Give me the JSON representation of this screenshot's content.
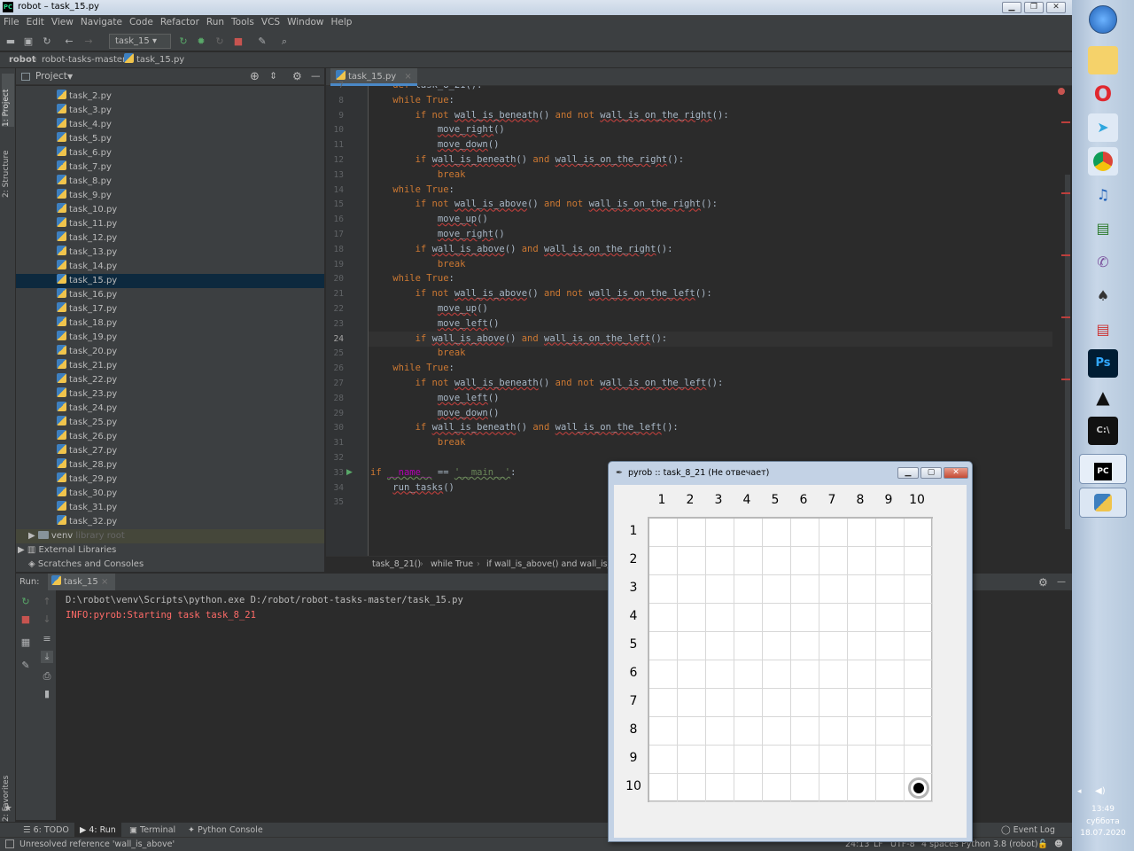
{
  "window": {
    "title": "robot – task_15.py"
  },
  "menu": [
    "File",
    "Edit",
    "View",
    "Navigate",
    "Code",
    "Refactor",
    "Run",
    "Tools",
    "VCS",
    "Window",
    "Help"
  ],
  "toolbar": {
    "run_config": "task_15"
  },
  "breadcrumb": {
    "project": "robot",
    "folder": "robot-tasks-master",
    "file": "task_15.py"
  },
  "left_tabs": {
    "project": "1: Project",
    "structure": "2: Structure",
    "favorites": "2: Favorites"
  },
  "project_panel": {
    "title": "Project",
    "files": [
      "task_2.py",
      "task_3.py",
      "task_4.py",
      "task_5.py",
      "task_6.py",
      "task_7.py",
      "task_8.py",
      "task_9.py",
      "task_10.py",
      "task_11.py",
      "task_12.py",
      "task_13.py",
      "task_14.py",
      "task_15.py",
      "task_16.py",
      "task_17.py",
      "task_18.py",
      "task_19.py",
      "task_20.py",
      "task_21.py",
      "task_22.py",
      "task_23.py",
      "task_24.py",
      "task_25.py",
      "task_26.py",
      "task_27.py",
      "task_28.py",
      "task_29.py",
      "task_30.py",
      "task_31.py",
      "task_32.py"
    ],
    "selected_file": "task_15.py",
    "venv": "venv",
    "venv_note": "library root",
    "external_libraries": "External Libraries",
    "scratches": "Scratches and Consoles"
  },
  "editor": {
    "tab": "task_15.py",
    "current_line": 24,
    "breadcrumb": [
      "task_8_21()",
      "while True",
      "if wall_is_above() and wall_is_..."
    ]
  },
  "run_panel": {
    "label": "Run:",
    "tab": "task_15",
    "console": [
      "D:\\robot\\venv\\Scripts\\python.exe D:/robot/robot-tasks-master/task_15.py",
      "INFO:pyrob:Starting task task_8_21"
    ]
  },
  "bottom_tabs": {
    "todo": "6: TODO",
    "run": "4: Run",
    "terminal": "Terminal",
    "python_console": "Python Console",
    "event_log": "Event Log"
  },
  "status": {
    "message": "Unresolved reference 'wall_is_above'",
    "position": "24:13",
    "line_sep": "LF",
    "encoding": "UTF-8",
    "indent": "4 spaces",
    "interpreter": "Python 3.8 (robot)"
  },
  "dialog": {
    "title": "pyrob :: task_8_21 (Не отвечает)",
    "columns": [
      "1",
      "2",
      "3",
      "4",
      "5",
      "6",
      "7",
      "8",
      "9",
      "10"
    ],
    "rows": [
      "1",
      "2",
      "3",
      "4",
      "5",
      "6",
      "7",
      "8",
      "9",
      "10"
    ],
    "robot_row": 10,
    "robot_col": 10
  },
  "tray": {
    "time": "13:49",
    "day": "суббота",
    "date": "18.07.2020"
  },
  "colors": {
    "ide_bg": "#2b2b2b",
    "panel": "#3c3f41",
    "keyword": "#cc7832",
    "selection": "#0d293e",
    "error": "#ff6b68"
  }
}
